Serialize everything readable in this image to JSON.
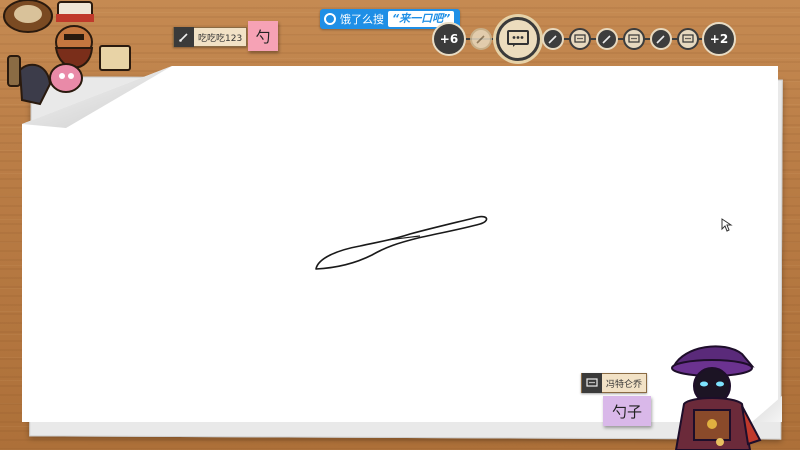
{
  "search_banner": {
    "prefix": "饿了么搜",
    "highlight": "“来一口吧”"
  },
  "players": {
    "left_more": "+6",
    "right_more": "+2"
  },
  "drawer": {
    "name": "吃吃吃123",
    "guess_note": "勺"
  },
  "guesser": {
    "name": "冯特仑乔",
    "answer_note": "勺子"
  },
  "colors": {
    "banner": "#1f8fe6",
    "paper": "#ffffff",
    "wood": "#b87a43",
    "pink_note": "#f6a2b5",
    "purple_note": "#d9b8e9"
  },
  "icons": [
    "brush-icon",
    "chat-bubble-icon",
    "cursor-icon"
  ]
}
